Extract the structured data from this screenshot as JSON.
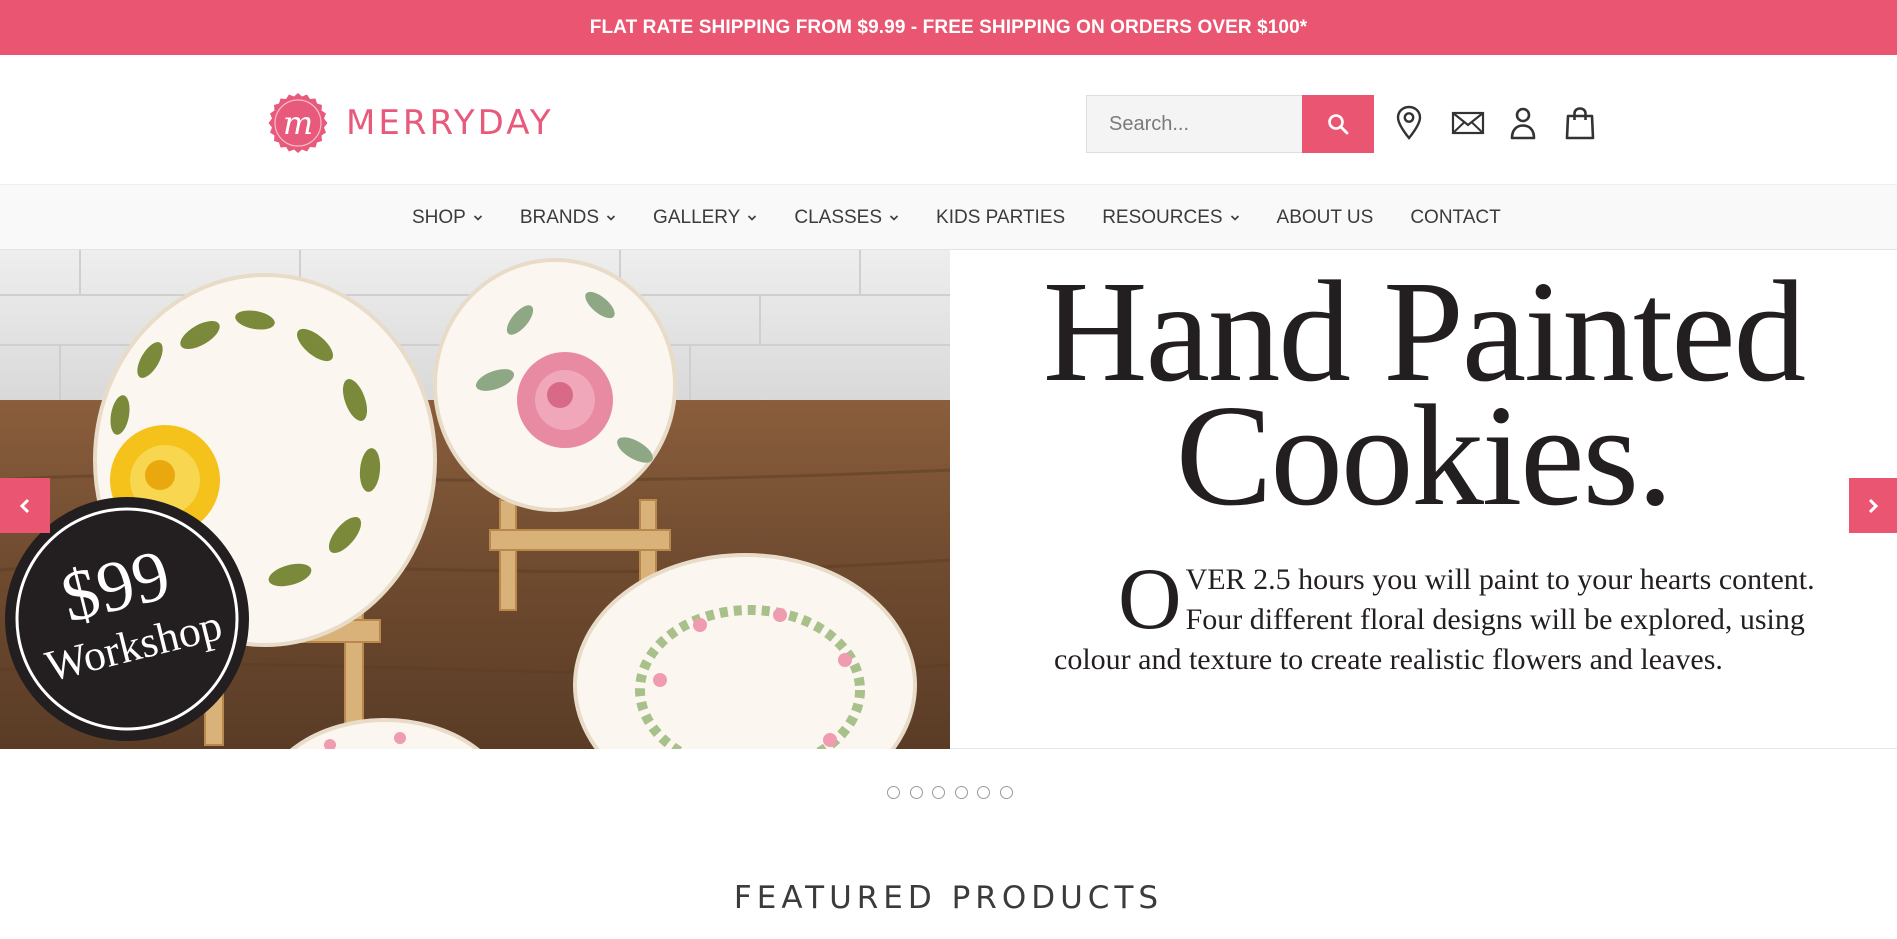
{
  "announcement": "FLAT RATE SHIPPING FROM $9.99 - FREE SHIPPING ON ORDERS OVER $100*",
  "brand": {
    "name": "MERRYDAY",
    "badge_letter": "m",
    "color": "#e85a7b"
  },
  "search": {
    "placeholder": "Search..."
  },
  "header_icons": [
    "location-icon",
    "mail-icon",
    "account-icon",
    "cart-icon"
  ],
  "nav": {
    "items": [
      {
        "label": "SHOP",
        "dropdown": true
      },
      {
        "label": "BRANDS",
        "dropdown": true
      },
      {
        "label": "GALLERY",
        "dropdown": true
      },
      {
        "label": "CLASSES",
        "dropdown": true
      },
      {
        "label": "KIDS PARTIES",
        "dropdown": false
      },
      {
        "label": "RESOURCES",
        "dropdown": true
      },
      {
        "label": "ABOUT US",
        "dropdown": false
      },
      {
        "label": "CONTACT",
        "dropdown": false
      }
    ]
  },
  "hero": {
    "title_line1": "Hand Painted",
    "title_line2": "Cookies.",
    "dropcap": "O",
    "body_line1": "VER 2.5 hours you will paint to your hearts content.",
    "body_line2": "Four different floral designs will be explored, using",
    "body_line3": "colour and texture to create realistic flowers and leaves.",
    "badge_price": "$99",
    "badge_label": "Workshop"
  },
  "slider": {
    "slide_count": 6,
    "active_index": 0
  },
  "section_title": "FEATURED PRODUCTS",
  "colors": {
    "accent": "#ea5672",
    "text_dark": "#231f20",
    "nav_bg": "#f9f9f9"
  }
}
